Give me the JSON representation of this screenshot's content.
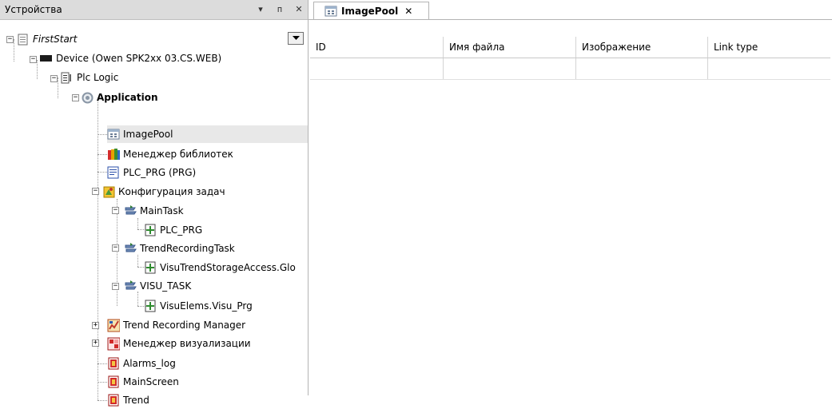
{
  "devices_panel": {
    "title": "Устройства",
    "buttons": [
      "▾",
      "ᴨ",
      "✕"
    ]
  },
  "tree": {
    "firststart": "FirstStart",
    "device": "Device (Owen SPK2xx 03.CS.WEB)",
    "plclogic": "Plc Logic",
    "application": "Application",
    "imagepool": "ImagePool",
    "libmanager": "Менеджер библиотек",
    "plc_prg": "PLC_PRG (PRG)",
    "taskconfig": "Конфигурация задач",
    "maintask": "MainTask",
    "maintask_plc_prg": "PLC_PRG",
    "trendrecordingtask": "TrendRecordingTask",
    "visutrendstorage": "VisuTrendStorageAccess.Glo",
    "visu_task": "VISU_TASK",
    "visuelems": "VisuElems.Visu_Prg",
    "trendrecmanager": "Trend Recording Manager",
    "visumanager": "Менеджер визуализации",
    "alarms_log": "Alarms_log",
    "mainscreen": "MainScreen",
    "trend": "Trend"
  },
  "editor": {
    "tab_label": "ImagePool",
    "tab_close": "✕",
    "columns": [
      "ID",
      "Имя файла",
      "Изображение",
      "Link type"
    ]
  }
}
